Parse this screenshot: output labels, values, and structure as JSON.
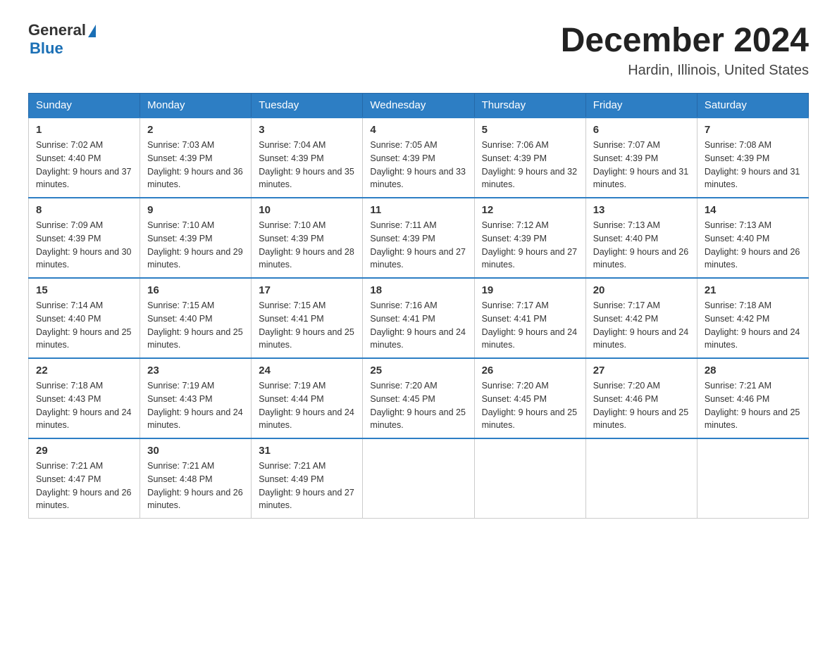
{
  "logo": {
    "general": "General",
    "arrow": "▶",
    "blue": "Blue"
  },
  "title": "December 2024",
  "location": "Hardin, Illinois, United States",
  "days_header": [
    "Sunday",
    "Monday",
    "Tuesday",
    "Wednesday",
    "Thursday",
    "Friday",
    "Saturday"
  ],
  "weeks": [
    [
      {
        "day": "1",
        "sunrise": "7:02 AM",
        "sunset": "4:40 PM",
        "daylight": "9 hours and 37 minutes."
      },
      {
        "day": "2",
        "sunrise": "7:03 AM",
        "sunset": "4:39 PM",
        "daylight": "9 hours and 36 minutes."
      },
      {
        "day": "3",
        "sunrise": "7:04 AM",
        "sunset": "4:39 PM",
        "daylight": "9 hours and 35 minutes."
      },
      {
        "day": "4",
        "sunrise": "7:05 AM",
        "sunset": "4:39 PM",
        "daylight": "9 hours and 33 minutes."
      },
      {
        "day": "5",
        "sunrise": "7:06 AM",
        "sunset": "4:39 PM",
        "daylight": "9 hours and 32 minutes."
      },
      {
        "day": "6",
        "sunrise": "7:07 AM",
        "sunset": "4:39 PM",
        "daylight": "9 hours and 31 minutes."
      },
      {
        "day": "7",
        "sunrise": "7:08 AM",
        "sunset": "4:39 PM",
        "daylight": "9 hours and 31 minutes."
      }
    ],
    [
      {
        "day": "8",
        "sunrise": "7:09 AM",
        "sunset": "4:39 PM",
        "daylight": "9 hours and 30 minutes."
      },
      {
        "day": "9",
        "sunrise": "7:10 AM",
        "sunset": "4:39 PM",
        "daylight": "9 hours and 29 minutes."
      },
      {
        "day": "10",
        "sunrise": "7:10 AM",
        "sunset": "4:39 PM",
        "daylight": "9 hours and 28 minutes."
      },
      {
        "day": "11",
        "sunrise": "7:11 AM",
        "sunset": "4:39 PM",
        "daylight": "9 hours and 27 minutes."
      },
      {
        "day": "12",
        "sunrise": "7:12 AM",
        "sunset": "4:39 PM",
        "daylight": "9 hours and 27 minutes."
      },
      {
        "day": "13",
        "sunrise": "7:13 AM",
        "sunset": "4:40 PM",
        "daylight": "9 hours and 26 minutes."
      },
      {
        "day": "14",
        "sunrise": "7:13 AM",
        "sunset": "4:40 PM",
        "daylight": "9 hours and 26 minutes."
      }
    ],
    [
      {
        "day": "15",
        "sunrise": "7:14 AM",
        "sunset": "4:40 PM",
        "daylight": "9 hours and 25 minutes."
      },
      {
        "day": "16",
        "sunrise": "7:15 AM",
        "sunset": "4:40 PM",
        "daylight": "9 hours and 25 minutes."
      },
      {
        "day": "17",
        "sunrise": "7:15 AM",
        "sunset": "4:41 PM",
        "daylight": "9 hours and 25 minutes."
      },
      {
        "day": "18",
        "sunrise": "7:16 AM",
        "sunset": "4:41 PM",
        "daylight": "9 hours and 24 minutes."
      },
      {
        "day": "19",
        "sunrise": "7:17 AM",
        "sunset": "4:41 PM",
        "daylight": "9 hours and 24 minutes."
      },
      {
        "day": "20",
        "sunrise": "7:17 AM",
        "sunset": "4:42 PM",
        "daylight": "9 hours and 24 minutes."
      },
      {
        "day": "21",
        "sunrise": "7:18 AM",
        "sunset": "4:42 PM",
        "daylight": "9 hours and 24 minutes."
      }
    ],
    [
      {
        "day": "22",
        "sunrise": "7:18 AM",
        "sunset": "4:43 PM",
        "daylight": "9 hours and 24 minutes."
      },
      {
        "day": "23",
        "sunrise": "7:19 AM",
        "sunset": "4:43 PM",
        "daylight": "9 hours and 24 minutes."
      },
      {
        "day": "24",
        "sunrise": "7:19 AM",
        "sunset": "4:44 PM",
        "daylight": "9 hours and 24 minutes."
      },
      {
        "day": "25",
        "sunrise": "7:20 AM",
        "sunset": "4:45 PM",
        "daylight": "9 hours and 25 minutes."
      },
      {
        "day": "26",
        "sunrise": "7:20 AM",
        "sunset": "4:45 PM",
        "daylight": "9 hours and 25 minutes."
      },
      {
        "day": "27",
        "sunrise": "7:20 AM",
        "sunset": "4:46 PM",
        "daylight": "9 hours and 25 minutes."
      },
      {
        "day": "28",
        "sunrise": "7:21 AM",
        "sunset": "4:46 PM",
        "daylight": "9 hours and 25 minutes."
      }
    ],
    [
      {
        "day": "29",
        "sunrise": "7:21 AM",
        "sunset": "4:47 PM",
        "daylight": "9 hours and 26 minutes."
      },
      {
        "day": "30",
        "sunrise": "7:21 AM",
        "sunset": "4:48 PM",
        "daylight": "9 hours and 26 minutes."
      },
      {
        "day": "31",
        "sunrise": "7:21 AM",
        "sunset": "4:49 PM",
        "daylight": "9 hours and 27 minutes."
      },
      null,
      null,
      null,
      null
    ]
  ]
}
